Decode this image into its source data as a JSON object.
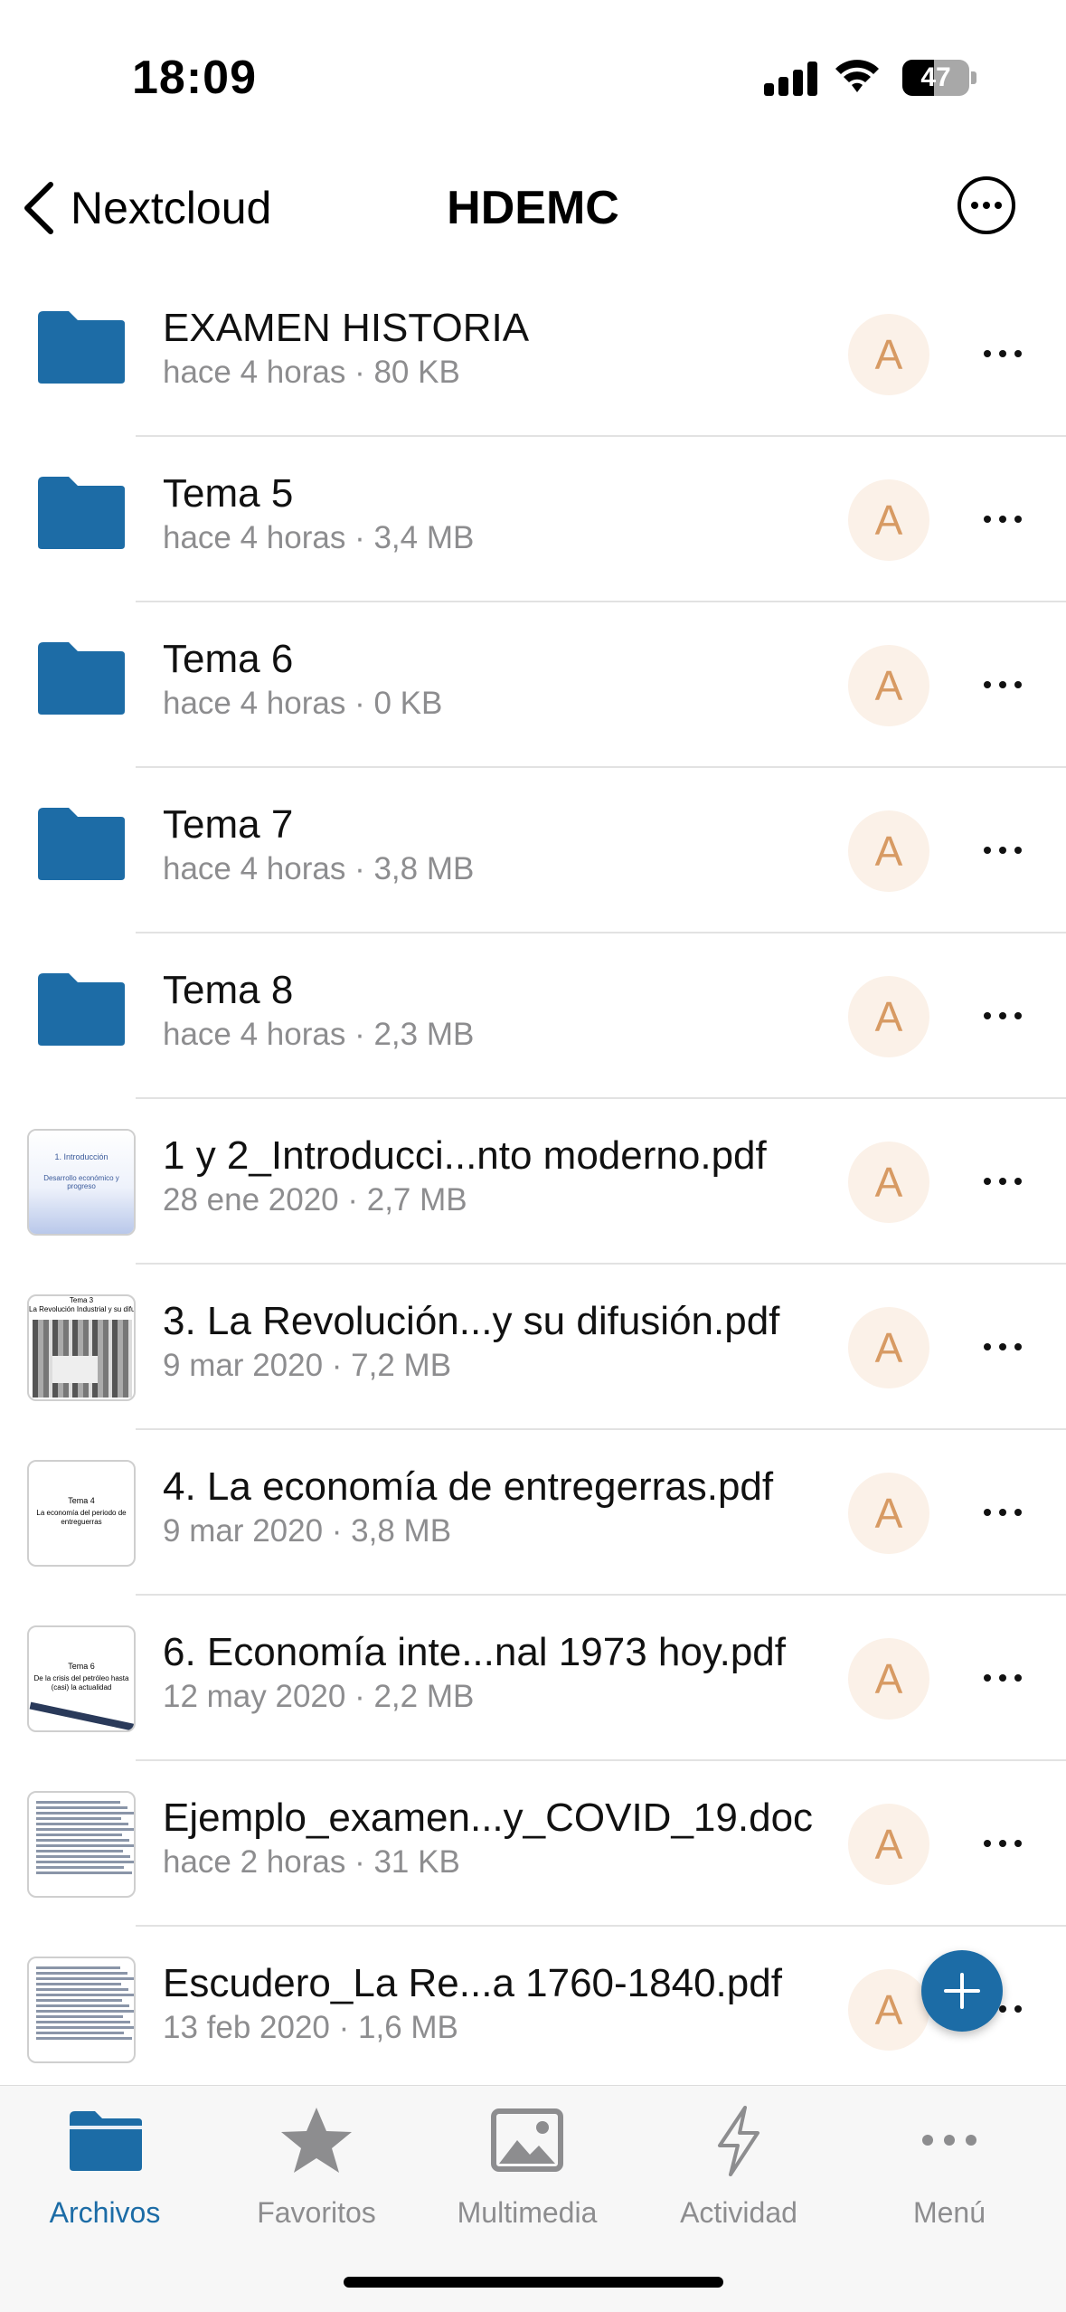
{
  "status": {
    "time": "18:09",
    "battery": "47",
    "battery_level": 0.47
  },
  "nav": {
    "back_label": "Nextcloud",
    "title": "HDEMC"
  },
  "items": [
    {
      "kind": "folder",
      "name": "EXAMEN HISTORIA",
      "meta": "hace 4 horas · 80 KB",
      "avatar": "A"
    },
    {
      "kind": "folder",
      "name": "Tema 5",
      "meta": "hace 4 horas · 3,4 MB",
      "avatar": "A"
    },
    {
      "kind": "folder",
      "name": "Tema 6",
      "meta": "hace 4 horas · 0 KB",
      "avatar": "A"
    },
    {
      "kind": "folder",
      "name": "Tema 7",
      "meta": "hace 4 horas · 3,8 MB",
      "avatar": "A"
    },
    {
      "kind": "folder",
      "name": "Tema 8",
      "meta": "hace 4 horas · 2,3 MB",
      "avatar": "A"
    },
    {
      "kind": "pdf",
      "name": "1 y 2_Introducci...nto moderno.pdf",
      "meta": "28 ene 2020 · 2,7 MB",
      "avatar": "A",
      "thumb_text": [
        "1. Introducción",
        "Desarrollo económico y progreso"
      ]
    },
    {
      "kind": "pdf",
      "name": "3. La Revolución...y su difusión.pdf",
      "meta": "9 mar 2020 · 7,2 MB",
      "avatar": "A",
      "thumb_text": [
        "Tema 3",
        "La Revolución Industrial y su difusión"
      ]
    },
    {
      "kind": "pdf",
      "name": "4. La economía de entregerras.pdf",
      "meta": "9 mar 2020 · 3,8 MB",
      "avatar": "A",
      "thumb_text": [
        "Tema 4",
        "La economía del periodo de entreguerras"
      ]
    },
    {
      "kind": "pdf",
      "name": "6. Economía inte...nal 1973 hoy.pdf",
      "meta": "12 may 2020 · 2,2 MB",
      "avatar": "A",
      "thumb_text": [
        "Tema 6",
        "De la crisis del petróleo hasta (casi) la actualidad"
      ]
    },
    {
      "kind": "doc",
      "name": "Ejemplo_examen...y_COVID_19.doc",
      "meta": "hace 2 horas · 31 KB",
      "avatar": "A"
    },
    {
      "kind": "pdf",
      "name": "Escudero_La Re...a 1760-1840.pdf",
      "meta": "13 feb 2020 · 1,6 MB",
      "avatar": "A"
    }
  ],
  "tabs": [
    {
      "label": "Archivos",
      "icon": "folder-icon",
      "active": true
    },
    {
      "label": "Favoritos",
      "icon": "star-icon",
      "active": false
    },
    {
      "label": "Multimedia",
      "icon": "photo-icon",
      "active": false
    },
    {
      "label": "Actividad",
      "icon": "bolt-icon",
      "active": false
    },
    {
      "label": "Menú",
      "icon": "more-icon",
      "active": false
    }
  ],
  "colors": {
    "accent": "#1c6ca6",
    "folder": "#1d6ca6",
    "avatar_bg": "#fbf1e8",
    "avatar_fg": "#d79a63",
    "meta": "#8d8d8f"
  }
}
